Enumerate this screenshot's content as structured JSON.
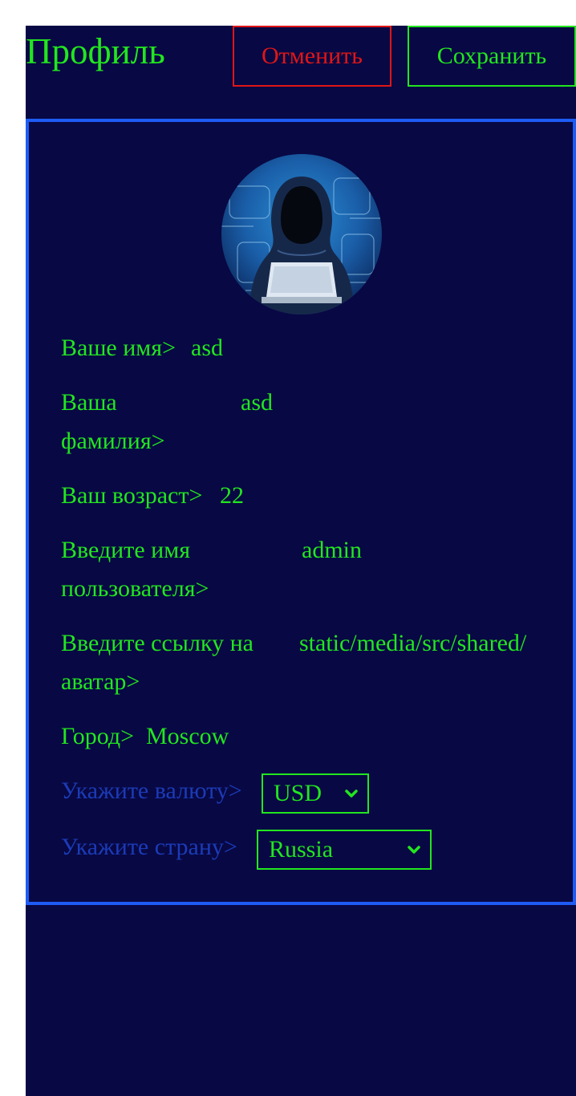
{
  "header": {
    "title": "Профиль",
    "cancel_label": "Отменить",
    "save_label": "Сохранить"
  },
  "profile": {
    "avatar_icon": "hacker-avatar-icon",
    "fields": [
      {
        "label": "Ваше имя>",
        "value": "asd"
      },
      {
        "label_line1": "Ваша",
        "label_line2": "фамилия>",
        "value": "asd"
      },
      {
        "label": "Ваш возраст>",
        "value": "22"
      },
      {
        "label_line1": "Введите имя",
        "label_line2": "пользователя>",
        "value": "admin"
      },
      {
        "label_line1": "Введите ссылку на",
        "label_line2": "аватар>",
        "value": "static/media/src/shared/"
      },
      {
        "label": "Город>",
        "value": "Moscow"
      }
    ],
    "currency": {
      "label": "Укажите валюту>",
      "selected": "USD"
    },
    "country": {
      "label": "Укажите страну>",
      "selected": "Russia"
    }
  },
  "colors": {
    "background": "#080844",
    "accent_green": "#22e61f",
    "cancel_red": "#e01616",
    "card_border": "#1e5cf5",
    "muted_label": "#1b3bb7"
  }
}
